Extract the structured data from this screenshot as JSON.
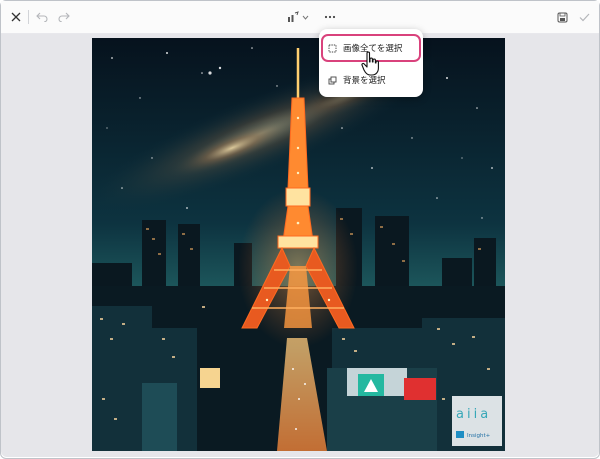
{
  "toolbar": {
    "icons": [
      "close-icon",
      "undo-icon",
      "redo-icon",
      "edit-style-icon",
      "chevron-down-icon",
      "more-icon",
      "save-icon",
      "check-icon"
    ]
  },
  "context_menu": {
    "items": [
      {
        "label": "画像全てを選択",
        "icon": "select-rect-icon",
        "highlighted": true
      },
      {
        "label": "背景を選択",
        "icon": "layers-icon",
        "highlighted": false
      }
    ]
  },
  "watermark": {
    "brand": "aiia",
    "badge": "Insight+"
  },
  "colors": {
    "highlight_border": "#d9427c",
    "canvas_bg": "#e6e6ea",
    "tower": "#ff7a2a"
  }
}
